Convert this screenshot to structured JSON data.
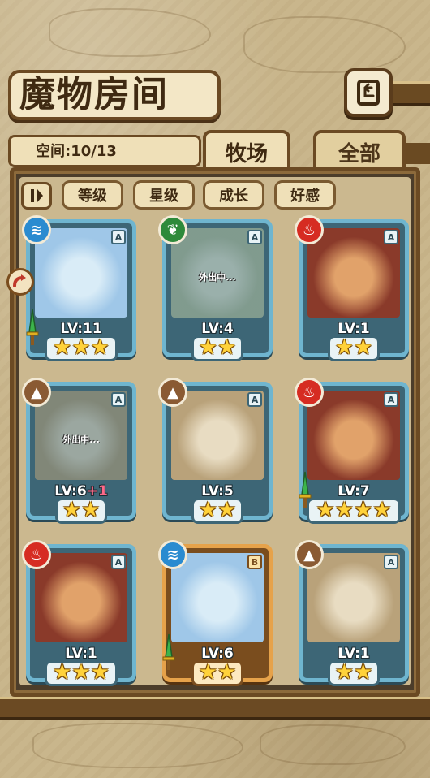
{
  "header": {
    "title": "魔物房间"
  },
  "tabs": {
    "space_label": "空间:10/13",
    "active_tab": "牧场",
    "other_tab": "全部"
  },
  "sort_buttons": [
    "等级",
    "星级",
    "成长",
    "好感"
  ],
  "colors": {
    "water": "#2a8bd0",
    "wood": "#2e8a3a",
    "fire": "#d62c22",
    "earth": "#8a5a33",
    "card_blue": "#6fb5cf",
    "card_gold": "#e6a24a",
    "star": "#ffd23a"
  },
  "cards": [
    {
      "element": "water",
      "rank": "A",
      "level": "LV:11",
      "plus": "",
      "stars": "★★★",
      "star_count": 3,
      "status": "",
      "equipped": true
    },
    {
      "element": "wood",
      "rank": "A",
      "level": "LV:4",
      "plus": "",
      "stars": "★★",
      "star_count": 2,
      "status": "外出中...",
      "equipped": false
    },
    {
      "element": "fire",
      "rank": "A",
      "level": "LV:1",
      "plus": "",
      "stars": "★★",
      "star_count": 2,
      "status": "",
      "equipped": false
    },
    {
      "element": "earth",
      "rank": "A",
      "level": "LV:6",
      "plus": "+1",
      "stars": "★★",
      "star_count": 2,
      "status": "外出中...",
      "equipped": false
    },
    {
      "element": "earth",
      "rank": "A",
      "level": "LV:5",
      "plus": "",
      "stars": "★★",
      "star_count": 2,
      "status": "",
      "equipped": false
    },
    {
      "element": "fire",
      "rank": "A",
      "level": "LV:7",
      "plus": "",
      "stars": "★★★★",
      "star_count": 4,
      "status": "",
      "equipped": true
    },
    {
      "element": "fire",
      "rank": "A",
      "level": "LV:1",
      "plus": "",
      "stars": "★★★",
      "star_count": 3,
      "status": "",
      "equipped": false
    },
    {
      "element": "water",
      "rank": "B",
      "level": "LV:6",
      "plus": "",
      "stars": "★★",
      "star_count": 2,
      "status": "",
      "equipped": true
    },
    {
      "element": "earth",
      "rank": "A",
      "level": "LV:1",
      "plus": "",
      "stars": "★★",
      "star_count": 2,
      "status": "",
      "equipped": false
    }
  ]
}
